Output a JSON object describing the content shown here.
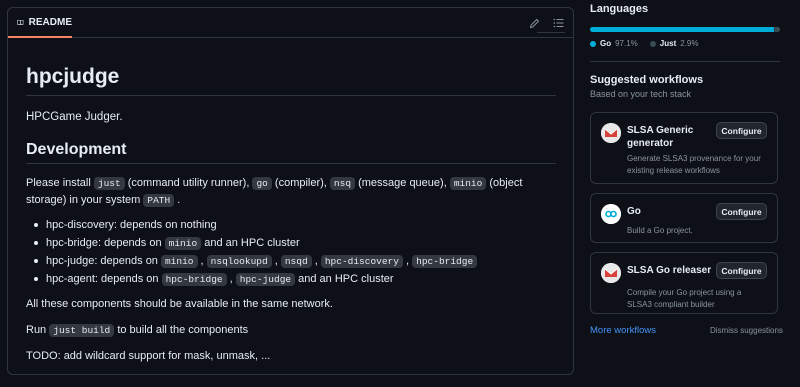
{
  "readme": {
    "tab_label": "README",
    "title": "hpcjudge",
    "description": "HPCGame Judger.",
    "section_title": "Development",
    "install": {
      "t1": "Please install ",
      "c1": "just",
      "t2": " (command utility runner), ",
      "c2": "go",
      "t3": " (compiler), ",
      "c3": "nsq",
      "t4": " (message queue), ",
      "c4": "minio",
      "t5": " (object storage) in your system ",
      "c5": "PATH",
      "t6": " ."
    },
    "components": [
      {
        "text": "hpc-discovery: depends on nothing"
      },
      {
        "text": "hpc-bridge: depends on ",
        "c1": "minio",
        "after": " and an HPC cluster"
      },
      {
        "text": "hpc-judge: depends on ",
        "c1": "minio",
        "c2": "nsqlookupd",
        "c3": "nsqd",
        "c4": "hpc-discovery",
        "c5": "hpc-bridge",
        "sep": " , "
      },
      {
        "text": "hpc-agent: depends on ",
        "c1": "hpc-bridge",
        "sep": " , ",
        "c2": "hpc-judge",
        "after": " and an HPC cluster"
      }
    ],
    "availability": "All these components should be available in the same network.",
    "run": {
      "before": "Run ",
      "code": "just build",
      "after": " to build all the components"
    },
    "todo": "TODO: add wildcard support for mask, unmask, ..."
  },
  "sidebar": {
    "languages_title": "Languages",
    "languages": [
      {
        "name": "Go",
        "percent": "97.1%",
        "share": 97.1,
        "color": "#00add8"
      },
      {
        "name": "Just",
        "percent": "2.9%",
        "share": 2.9,
        "color": "#384d54"
      }
    ],
    "workflows_title": "Suggested workflows",
    "workflows_subtitle": "Based on your tech stack",
    "workflows": [
      {
        "name": "SLSA Generic generator",
        "description": "Generate SLSA3 provenance for your existing release workflows",
        "button": "Configure",
        "icon": "slsa-icon"
      },
      {
        "name": "Go",
        "description": "Build a Go project.",
        "button": "Configure",
        "icon": "go-icon"
      },
      {
        "name": "SLSA Go releaser",
        "description": "Compile your Go project using a SLSA3 compliant builder",
        "button": "Configure",
        "icon": "slsa-icon"
      }
    ],
    "more_workflows": "More workflows",
    "dismiss": "Dismiss suggestions"
  }
}
